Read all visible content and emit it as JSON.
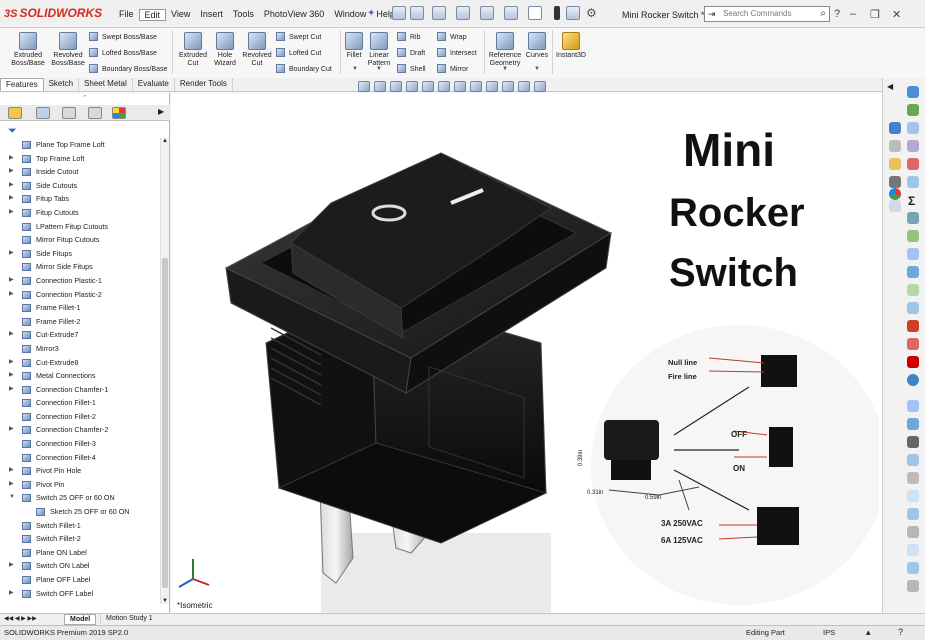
{
  "app": {
    "brand": "SOLIDWORKS",
    "document_title": "Mini Rocker Switch *"
  },
  "menu": [
    "File",
    "Edit",
    "View",
    "Insert",
    "Tools",
    "PhotoView 360",
    "Window",
    "Help"
  ],
  "search": {
    "placeholder": "Search Commands"
  },
  "commands": {
    "extruded_boss": "Extruded\nBoss/Base",
    "revolved_boss": "Revolved\nBoss/Base",
    "swept_boss": "Swept Boss/Base",
    "lofted_boss": "Lofted Boss/Base",
    "boundary_boss": "Boundary Boss/Base",
    "extruded_cut": "Extruded\nCut",
    "hole_wizard": "Hole\nWizard",
    "revolved_cut": "Revolved\nCut",
    "swept_cut": "Swept Cut",
    "lofted_cut": "Lofted Cut",
    "boundary_cut": "Boundary Cut",
    "fillet": "Fillet",
    "linear_pattern": "Linear\nPattern",
    "rib": "Rib",
    "draft": "Draft",
    "shell": "Shell",
    "wrap": "Wrap",
    "intersect": "Intersect",
    "mirror": "Mirror",
    "reference_geometry": "Reference\nGeometry",
    "curves": "Curves",
    "instant3d": "Instant3D"
  },
  "tabs": [
    "Features",
    "Sketch",
    "Sheet Metal",
    "Evaluate",
    "Render Tools"
  ],
  "tree": [
    {
      "label": "Plane Top Frame Loft",
      "expand": false
    },
    {
      "label": "Top Frame Loft",
      "expand": true
    },
    {
      "label": "Inside Cutout",
      "expand": true
    },
    {
      "label": "Side Cutouts",
      "expand": true
    },
    {
      "label": "Fitup Tabs",
      "expand": true
    },
    {
      "label": "Fitup Cutouts",
      "expand": true
    },
    {
      "label": "LPattern Fitup Cutouts",
      "expand": false
    },
    {
      "label": "Mirror Fitup Cutouts",
      "expand": false
    },
    {
      "label": "Side Fitups",
      "expand": true
    },
    {
      "label": "Mirror Side Fitups",
      "expand": false
    },
    {
      "label": "Connection Plastic-1",
      "expand": true
    },
    {
      "label": "Connection Plastic-2",
      "expand": true
    },
    {
      "label": "Frame Fillet-1",
      "expand": false
    },
    {
      "label": "Frame Fillet-2",
      "expand": false
    },
    {
      "label": "Cut-Extrude7",
      "expand": true
    },
    {
      "label": "Mirror3",
      "expand": false
    },
    {
      "label": "Cut-Extrude8",
      "expand": true
    },
    {
      "label": "Metal Connections",
      "expand": true
    },
    {
      "label": "Connection Chamfer-1",
      "expand": true
    },
    {
      "label": "Connection Fillet-1",
      "expand": false
    },
    {
      "label": "Connection Fillet-2",
      "expand": false
    },
    {
      "label": "Connection Chamfer-2",
      "expand": true
    },
    {
      "label": "Connection Fillet-3",
      "expand": false
    },
    {
      "label": "Connection Fillet-4",
      "expand": false
    },
    {
      "label": "Pivot Pin Hole",
      "expand": true
    },
    {
      "label": "Pivot Pin",
      "expand": true
    },
    {
      "label": "Switch 25 OFF or 60 ON",
      "expand": true,
      "open": true
    },
    {
      "label": "Sketch 25 OFF or 60 ON",
      "expand": false,
      "child": true
    },
    {
      "label": "Switch Fillet-1",
      "expand": false
    },
    {
      "label": "Switch Fillet-2",
      "expand": false
    },
    {
      "label": "Plane ON Label",
      "expand": false
    },
    {
      "label": "Switch ON Label",
      "expand": true
    },
    {
      "label": "Plane OFF Label",
      "expand": false
    },
    {
      "label": "Switch OFF Label",
      "expand": true
    }
  ],
  "viewport": {
    "title_lines": [
      "Mini",
      "Rocker",
      "Switch"
    ],
    "view_label": "*Isometric",
    "inset": {
      "null_line": "Null line",
      "fire_line": "Fire line",
      "off": "OFF",
      "on": "ON",
      "dim_a": "0.31in",
      "dim_b": "0.59in",
      "dim_c": "0.39in",
      "rating1": "3A  250VAC",
      "rating2": "6A  125VAC"
    }
  },
  "bottom_tabs": [
    "Model",
    "Motion Study 1"
  ],
  "status": {
    "product": "SOLIDWORKS Premium 2019 SP2.0",
    "mode": "Editing Part",
    "units": "IPS"
  }
}
